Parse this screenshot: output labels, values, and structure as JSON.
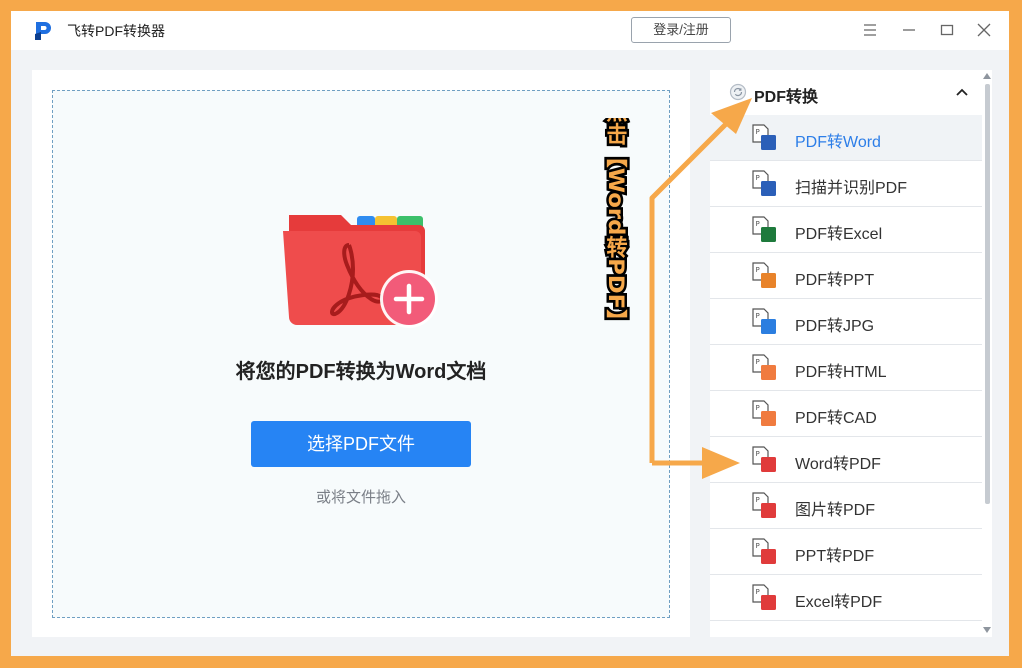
{
  "app": {
    "title": "飞转PDF转换器",
    "login_label": "登录/注册"
  },
  "dropzone": {
    "title": "将您的PDF转换为Word文档",
    "select_button": "选择PDF文件",
    "drag_hint": "或将文件拖入"
  },
  "sidebar": {
    "section_title": "PDF转换",
    "items": [
      {
        "label": "PDF转Word",
        "icon": "word-doc-icon",
        "color": "#2b5fb8",
        "active": true
      },
      {
        "label": "扫描并识别PDF",
        "icon": "word-doc-icon",
        "color": "#2b5fb8"
      },
      {
        "label": "PDF转Excel",
        "icon": "excel-doc-icon",
        "color": "#1e7a3c"
      },
      {
        "label": "PDF转PPT",
        "icon": "ppt-doc-icon",
        "color": "#e8832a"
      },
      {
        "label": "PDF转JPG",
        "icon": "image-doc-icon",
        "color": "#2b7ee0"
      },
      {
        "label": "PDF转HTML",
        "icon": "html-doc-icon",
        "color": "#f07b3f"
      },
      {
        "label": "PDF转CAD",
        "icon": "cad-doc-icon",
        "color": "#f07b3f"
      },
      {
        "label": "Word转PDF",
        "icon": "pdf-doc-icon",
        "color": "#e03b3b"
      },
      {
        "label": "图片转PDF",
        "icon": "pdf-doc-icon",
        "color": "#e03b3b"
      },
      {
        "label": "PPT转PDF",
        "icon": "pdf-doc-icon",
        "color": "#e03b3b"
      },
      {
        "label": "Excel转PDF",
        "icon": "pdf-doc-icon",
        "color": "#e03b3b"
      }
    ]
  },
  "annotation": {
    "text": "在PDF转换列表里点击【Word转PDF】",
    "color": "#f6a84a"
  },
  "colors": {
    "accent": "#2684f4",
    "frame": "#f6a84a"
  }
}
